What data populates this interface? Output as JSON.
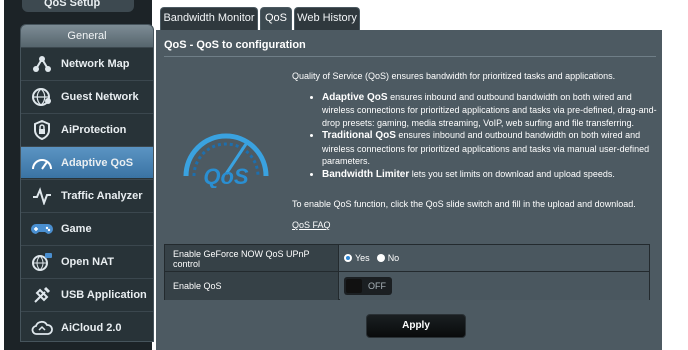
{
  "sidebar": {
    "setup_label": "QoS Setup",
    "section_title": "General",
    "items": [
      {
        "label": "Network Map",
        "icon": "network-map-icon",
        "active": false
      },
      {
        "label": "Guest Network",
        "icon": "guest-network-icon",
        "active": false
      },
      {
        "label": "AiProtection",
        "icon": "aiprotection-icon",
        "active": false
      },
      {
        "label": "Adaptive QoS",
        "icon": "adaptive-qos-icon",
        "active": true
      },
      {
        "label": "Traffic Analyzer",
        "icon": "traffic-analyzer-icon",
        "active": false
      },
      {
        "label": "Game",
        "icon": "game-icon",
        "active": false
      },
      {
        "label": "Open NAT",
        "icon": "open-nat-icon",
        "active": false
      },
      {
        "label": "USB Application",
        "icon": "usb-application-icon",
        "active": false
      },
      {
        "label": "AiCloud 2.0",
        "icon": "aicloud-icon",
        "active": false
      }
    ]
  },
  "tabs": [
    {
      "label": "Bandwidth Monitor",
      "active": false
    },
    {
      "label": "QoS",
      "active": true
    },
    {
      "label": "Web History",
      "active": false
    }
  ],
  "main": {
    "title": "QoS - QoS to configuration",
    "intro": "Quality of Service (QoS) ensures bandwidth for prioritized tasks and applications.",
    "bullets": [
      {
        "term": "Adaptive QoS",
        "text": " ensures inbound and outbound bandwidth on both wired and wireless connections for prioritized applications and tasks via pre-defined, drag-and-drop presets: gaming, media streaming, VoIP, web surfing and file transferring."
      },
      {
        "term": "Traditional QoS",
        "text": " ensures inbound and outbound bandwidth on both wired and wireless connections for prioritized applications and tasks via manual user-defined parameters."
      },
      {
        "term": "Bandwidth Limiter",
        "text": " lets you set limits on download and upload speeds."
      }
    ],
    "enable_text": "To enable QoS function, click the QoS slide switch and fill in the upload and download.",
    "faq_link": "QoS FAQ",
    "logo_text": "QoS"
  },
  "settings": {
    "geforce_label": "Enable GeForce NOW QoS UPnP control",
    "yes_label": "Yes",
    "no_label": "No",
    "geforce_selected": "Yes",
    "enable_qos_label": "Enable QoS",
    "toggle_state": "OFF"
  },
  "apply_label": "Apply",
  "colors": {
    "sidebar_bg": "#1c2327",
    "panel_bg": "#4d5a62",
    "active_item": "#3a73a3",
    "accent_blue": "#2c86d6"
  }
}
